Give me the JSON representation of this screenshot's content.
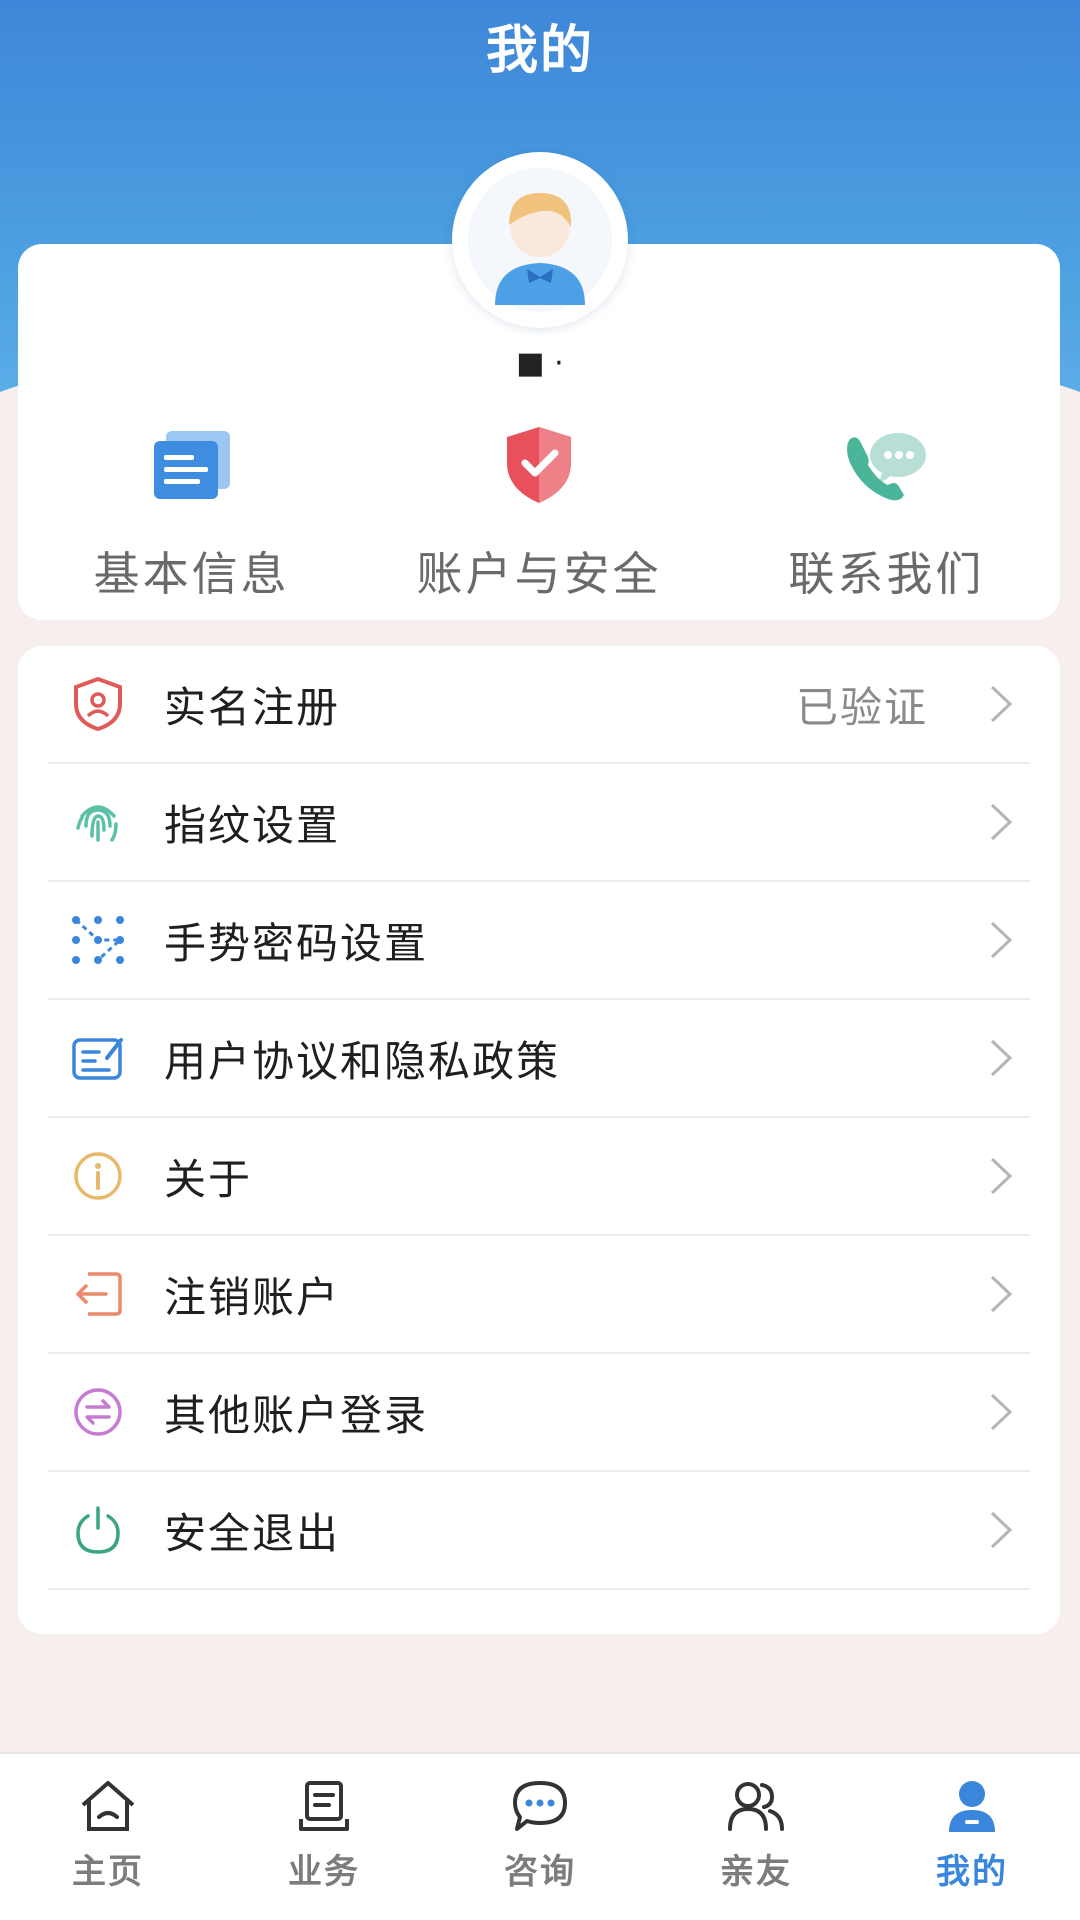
{
  "header": {
    "title": "我的"
  },
  "profile": {
    "username": "■ ·"
  },
  "quick_actions": [
    {
      "label": "基本信息",
      "icon": "id-card-icon"
    },
    {
      "label": "账户与安全",
      "icon": "shield-check-icon"
    },
    {
      "label": "联系我们",
      "icon": "phone-chat-icon"
    }
  ],
  "menu": {
    "items": [
      {
        "label": "实名注册",
        "value": "已验证",
        "icon": "verified-shield-icon"
      },
      {
        "label": "指纹设置",
        "value": "",
        "icon": "fingerprint-icon"
      },
      {
        "label": "手势密码设置",
        "value": "",
        "icon": "gesture-pattern-icon"
      },
      {
        "label": "用户协议和隐私政策",
        "value": "",
        "icon": "agreement-icon"
      },
      {
        "label": "关于",
        "value": "",
        "icon": "info-icon"
      },
      {
        "label": "注销账户",
        "value": "",
        "icon": "exit-door-icon"
      },
      {
        "label": "其他账户登录",
        "value": "",
        "icon": "switch-account-icon"
      },
      {
        "label": "安全退出",
        "value": "",
        "icon": "power-icon"
      }
    ]
  },
  "tabbar": {
    "tabs": [
      {
        "label": "主页",
        "icon": "home-icon"
      },
      {
        "label": "业务",
        "icon": "business-icon"
      },
      {
        "label": "咨询",
        "icon": "chat-bubble-icon"
      },
      {
        "label": "亲友",
        "icon": "contacts-icon"
      },
      {
        "label": "我的",
        "icon": "user-icon",
        "active": true
      }
    ]
  },
  "colors": {
    "primary": "#3a86dc",
    "background": "#f7eeee"
  }
}
